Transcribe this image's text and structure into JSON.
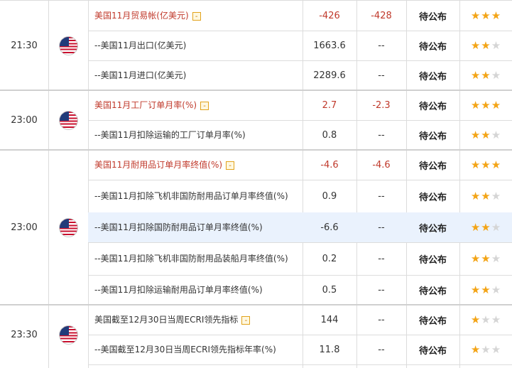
{
  "colors": {
    "major_text": "#c0392b",
    "star_on": "#f3a416",
    "star_off": "#d5d5d5",
    "highlight_row": "#eaf2fd"
  },
  "groups": [
    {
      "time": "21:30",
      "flag_icon": "us-flag-icon",
      "rows": [
        {
          "indicator": "美国11月贸易帐(亿美元)",
          "major": true,
          "toggle": "-",
          "previous": "-426",
          "forecast": "-428",
          "actual": "待公布",
          "stars": 3
        },
        {
          "indicator": "--美国11月出口(亿美元)",
          "major": false,
          "previous": "1663.6",
          "forecast": "--",
          "actual": "待公布",
          "stars": 2
        },
        {
          "indicator": "--美国11月进口(亿美元)",
          "major": false,
          "previous": "2289.6",
          "forecast": "--",
          "actual": "待公布",
          "stars": 2
        }
      ]
    },
    {
      "time": "23:00",
      "flag_icon": "us-flag-icon",
      "rows": [
        {
          "indicator": "美国11月工厂订单月率(%)",
          "major": true,
          "toggle": "-",
          "previous": "2.7",
          "forecast": "-2.3",
          "actual": "待公布",
          "stars": 3
        },
        {
          "indicator": "--美国11月扣除运输的工厂订单月率(%)",
          "major": false,
          "previous": "0.8",
          "forecast": "--",
          "actual": "待公布",
          "stars": 2
        }
      ]
    },
    {
      "time": "23:00",
      "flag_icon": "us-flag-icon",
      "rows": [
        {
          "indicator": "美国11月耐用品订单月率终值(%)",
          "major": true,
          "toggle": "-",
          "previous": "-4.6",
          "forecast": "-4.6",
          "actual": "待公布",
          "stars": 3
        },
        {
          "indicator": "--美国11月扣除飞机非国防耐用品订单月率终值(%)",
          "major": false,
          "previous": "0.9",
          "forecast": "--",
          "actual": "待公布",
          "stars": 2
        },
        {
          "indicator": "--美国11月扣除国防耐用品订单月率终值(%)",
          "major": false,
          "previous": "-6.6",
          "forecast": "--",
          "actual": "待公布",
          "stars": 2,
          "highlighted": true
        },
        {
          "indicator": "--美国11月扣除飞机非国防耐用品装船月率终值(%)",
          "major": false,
          "previous": "0.2",
          "forecast": "--",
          "actual": "待公布",
          "stars": 2
        },
        {
          "indicator": "--美国11月扣除运输耐用品订单月率终值(%)",
          "major": false,
          "previous": "0.5",
          "forecast": "--",
          "actual": "待公布",
          "stars": 2
        }
      ]
    },
    {
      "time": "23:30",
      "flag_icon": "us-flag-icon",
      "rows": [
        {
          "indicator": "美国截至12月30日当周ECRI领先指标",
          "major": false,
          "toggle": "-",
          "previous": "144",
          "forecast": "--",
          "actual": "待公布",
          "stars": 1
        },
        {
          "indicator": "--美国截至12月30日当周ECRI领先指标年率(%)",
          "major": false,
          "previous": "11.8",
          "forecast": "--",
          "actual": "待公布",
          "stars": 1
        }
      ]
    }
  ]
}
